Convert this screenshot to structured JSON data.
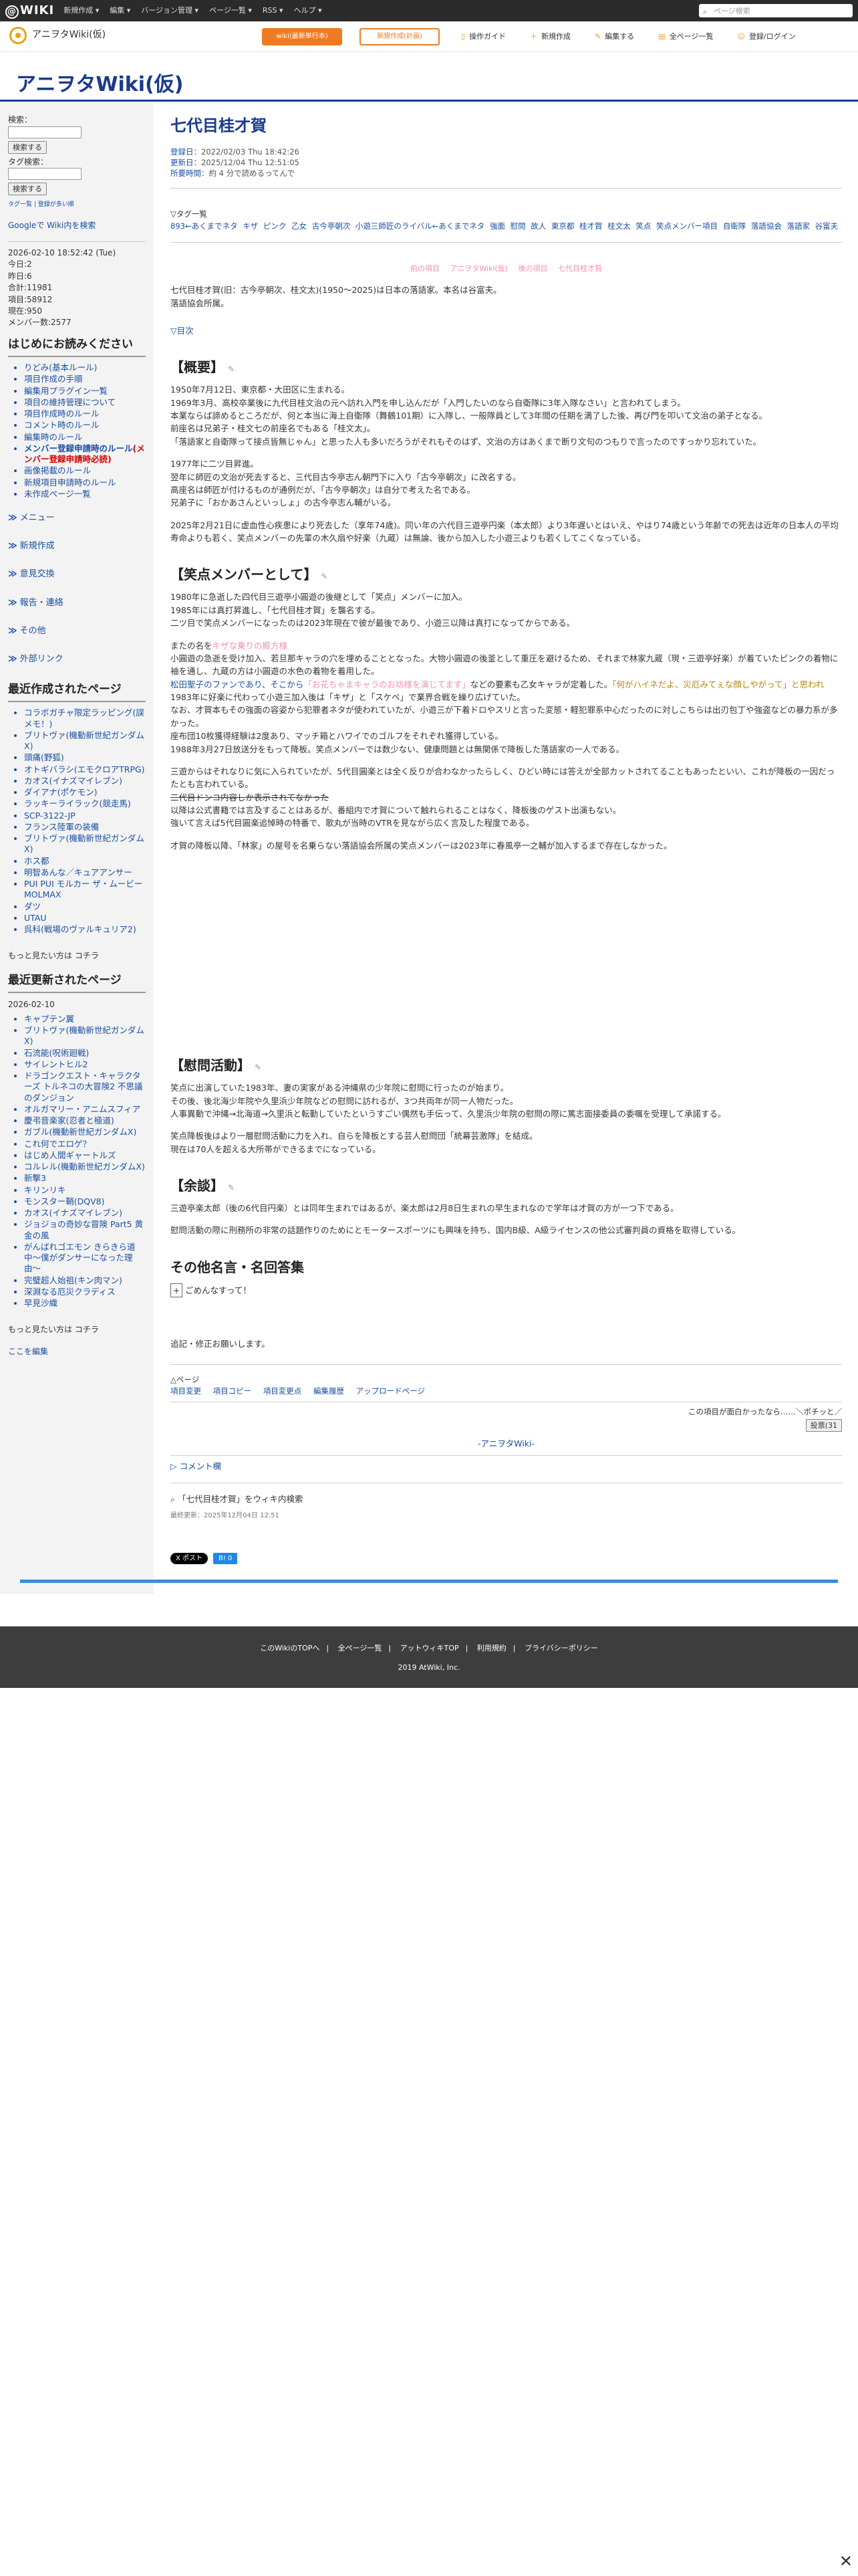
{
  "topbar": {
    "logo": "WIKI",
    "menu": [
      "新規作成 ▾",
      "編集 ▾",
      "バージョン管理 ▾",
      "ページ一覧 ▾",
      "RSS ▾",
      "ヘルプ ▾"
    ],
    "search_placeholder": "ページ検索"
  },
  "header": {
    "sitename": "アニヲタWiki(仮)",
    "btn_rank": "wiki(最新単行本)",
    "btn_ad": "新規作成(計画)",
    "links": [
      "操作ガイド",
      "新規作成",
      "編集する",
      "全ページ一覧",
      "登録/ログイン"
    ]
  },
  "title": "アニヲタWiki(仮)",
  "sidebar": {
    "search_label": "検索：",
    "search_btn": "検索する",
    "tag_label": "タグ検索：",
    "tag_btn": "検索する",
    "tag_link": "タグ一覧 | 登録が多い順",
    "google": "Googleで Wiki内を検索",
    "stats": [
      "2026-02-10 18:52:42 (Tue)",
      "今日:2",
      "昨日:6",
      "合計:11981",
      "項目:58912",
      "現在:950",
      "メンバー数:2577"
    ],
    "welcome_title": "はじめにお読みください",
    "welcome": [
      "りどみ(基本ルール)",
      "項目作成の手順",
      "編集用プラグイン一覧",
      "項目の維持管理について",
      "項目作成時のルール",
      "コメント時のルール",
      "編集時のルール"
    ],
    "member_rule": "メンバー登録申請時のルール",
    "member_rule_red": "(メンバー登録申請時必読)",
    "welcome2": [
      "画像掲載のルール",
      "新規項目申請時のルール",
      "未作成ページ一覧"
    ],
    "groups": [
      "メニュー",
      "新規作成",
      "意見交換",
      "報告・連絡",
      "その他",
      "外部リンク"
    ],
    "recent_title": "最近作成されたページ",
    "recent": [
      "コラボガチャ限定ラッピング(誤メモ！)",
      "ブリトヴァ(機動新世紀ガンダムX)",
      "頭痛(野狐)",
      "オトギバラシ(エモクロアTRPG)",
      "カオス(イナズマイレブン)",
      "ダイアナ(ポケモン)",
      "ラッキーライラック(競走馬)",
      "SCP-3122-JP",
      "フランス陸軍の装備",
      "ブリトヴァ(機動新世紀ガンダムX)",
      "ホス都",
      "明智あんな／キュアアンサー",
      "PUI PUI モルカー ザ・ムービー MOLMAX",
      "ダツ",
      "UTAU",
      "呉科(戦場のヴァルキュリア2)"
    ],
    "more1": "もっと見たい方は コチラ",
    "updated_title": "最近更新されたページ",
    "updated_date": "2026-02-10",
    "updated": [
      "キャプテン翼",
      "ブリトヴァ(機動新世紀ガンダムX)",
      "石流能(呪術廻戦)",
      "サイレントヒル2",
      "ドラゴンクエスト・キャラクターズ トルネコの大冒険2 不思議のダンジョン",
      "オルガマリー・アニムスフィア",
      "慶弔音楽家(忍者と極道)",
      "ガブル(機動新世紀ガンダムX)",
      "これ何でエロゲ？",
      "はじめ人間ギャートルズ",
      "コルレル(機動新世紀ガンダムX)",
      "新撃3",
      "キリンリキ",
      "モンスター鞘(DQV8)",
      "カオス(イナズマイレブン)",
      "ジョジョの奇妙な冒険 Part5 黄金の風",
      "がんばれゴエモン きらきら道中〜僕がダンサーになった理由〜",
      "完璧超人始祖(キン肉マン)",
      "深淵なる厄災クラディス",
      "早見沙織"
    ],
    "more2": "もっと見たい方は コチラ",
    "edit_here": "ここを編集"
  },
  "main": {
    "page_title": "七代目桂才賀",
    "meta": [
      {
        "k": "登録日",
        "v": "：2022/02/03 Thu 18:42:26"
      },
      {
        "k": "更新日",
        "v": "：2025/12/04 Thu 12:51:05"
      },
      {
        "k": "所要時間",
        "v": "：約 4 分で読めるってんで"
      }
    ],
    "tag_head": "▽タグ一覧",
    "tags": [
      "893←あくまでネタ",
      "キザ",
      "ピンク",
      "乙女",
      "古今亭朝次",
      "小遊三師匠のライバル←あくまでネタ",
      "強面",
      "慰問",
      "故人",
      "東京都",
      "桂才賀",
      "桂文太",
      "笑点",
      "笑点メンバー項目",
      "自衛隊",
      "落語協会",
      "落語家",
      "谷富夫"
    ],
    "nav": [
      "前の項目",
      "アニヲタWiki(仮)",
      "後の項目",
      "七代目桂才賀"
    ],
    "lead1": "七代目桂才賀(旧：古今亭朝次、桂文太)(1950〜2025)は日本の落語家。本名は谷富夫。",
    "lead2": "落語協会所属。",
    "toc": "▽目次",
    "sec1": "【概要】",
    "p1": [
      "1950年7月12日、東京都・大田区に生まれる。",
      "1969年3月、高校卒業後に九代目桂文治の元へ訪れ入門を申し込んだが「入門したいのなら自衛隊に3年入隊なさい」と言われてしまう。",
      "本業ならば諦めるところだが、何と本当に海上自衛隊（舞鶴101期）に入隊し、一般隊員として3年間の任期を満了した後、再び門を叩いて文治の弟子となる。",
      "前座名は兄弟子・桂文七の前座名でもある「桂文太」。",
      "「落語家と自衛隊って接点皆無じゃん」と思った人も多いだろうがそれもそのはず、文治の方はあくまで断り文句のつもりで言ったのですっかり忘れていた。"
    ],
    "p2": [
      "1977年に二ツ目昇進。",
      "翌年に師匠の文治が死去すると、三代目古今亭志ん朝門下に入り「古今亭朝次」に改名する。",
      "高座名は師匠が付けるものが通例だが、「古今亭朝次」は自分で考えた名である。",
      "兄弟子に「おかあさんといっしょ」の古今亭志ん輔がいる。"
    ],
    "p3": [
      "2025年2月21日に虚血性心疾患により死去した（享年74歳)。同い年の六代目三遊亭円楽（本太郎）より3年遅いとはいえ、やはり74歳という年齢での死去は近年の日本人の平均寿命よりも若く、笑点メンバーの先輩の木久扇や好楽（九蔵）は無論、後から加入した小遊三よりも若くしてこくなっている。"
    ],
    "sec2": "【笑点メンバーとして】",
    "p4": [
      "1980年に急逝した四代目三遊亭小圓遊の後継として「笑点」メンバーに加入。",
      "1985年には真打昇進し、「七代目桂才賀」を襲名する。",
      "二ツ目で笑点メンバーになったのは2023年現在で彼が最後であり、小遊三以降は真打になってからである。"
    ],
    "p5a": "またの名を",
    "p5a_pink": "キザな乗りの殿方様",
    "p5": [
      "小圓遊の急逝を受け加入、若旦那キャラの穴を埋めることとなった。大物小圓遊の後釜として重圧を避けるため、それまで林家九蔵（現・三遊亭好楽）が着ていたピンクの着物に袖を通し、九蔵の方は小圓遊の水色の着物を着用した。"
    ],
    "p5b": "松田聖子のファンであり、そこから",
    "p5b_pink": "「お花ちゃまキャラのお坊様を演じてます」",
    "p5c": "などの要素も乙女キャラが定着した。",
    "p5c_gold": "「何がハイネだよ、災厄みてぇな顔しやがって」と思われ",
    "p6": [
      "1983年に好楽に代わって小遊三加入後は「キザ」と「スケベ」で業界合戦を繰り広げていた。",
      "なお、才賀本もその強面の容姿から犯罪者ネタが使われていたが、小遊三が下着ドロやスリと言った変態・軽犯罪系中心だったのに対しこちらは出刃包丁や強盗などの暴力系が多かった。",
      "座布団10枚獲得経験は2度あり、マッチ箱とハワイでのゴルフをそれぞれ獲得している。",
      "1988年3月27日放送分をもって降板。笑点メンバーでは数少ない、健康問題とは無関係で降板した落語家の一人である。"
    ],
    "p7": [
      "三遊からはそれなりに気に入られていたが、5代目圓楽とは全く反りが合わなかったらしく、ひどい時には答えが全部カットされてることもあったといい、これが降板の一因だったとも言われている。"
    ],
    "p7_strike": "二代目ドンコ内容しか表示されてなかった",
    "p8": [
      "以降は公式書籍では言及することはあるが、番組内で才賀について触れられることはなく、降板後のゲスト出演もない。",
      "強いて言えば5代目圓楽追悼時の特番で、歌丸が当時のVTRを見ながら広く言及した程度である。"
    ],
    "p9": [
      "才賀の降板以降、「林家」の屋号を名乗らない落語協会所属の笑点メンバーは2023年に春風亭一之輔が加入するまで存在しなかった。"
    ],
    "sec3": "【慰問活動】",
    "p10": [
      "笑点に出演していた1983年、妻の実家がある沖縄県の少年院に慰問に行ったのが始まり。",
      "その後、後北海少年院や久里浜少年院などの慰問に訪れるが、3つ共両年が同一人物だった。",
      "人事異動で沖縄→北海道→久里浜と転勤していたというすごい偶然も手伝って、久里浜少年院の慰問の際に篤志面接委員の委嘱を受理して承諾する。"
    ],
    "p11": [
      "笑点降板後はより一層慰問活動に力を入れ、自らを降板とする芸人慰問団「統幕芸激隊」を結成。",
      "現在は70人を超える大所帯ができるまでになっている。"
    ],
    "sec4": "【余談】",
    "p12": [
      "三遊亭楽太郎（後の6代目円楽）とは同年生まれではあるが、楽太郎は2月8日生まれの早生まれなので学年は才賀の方が一つ下である。"
    ],
    "p13": [
      "慰問活動の際に刑務所の非常の話題作りのためにとモータースポーツにも興味を持ち、国内B級、A級ライセンスの他公式審判員の資格を取得している。"
    ],
    "sec5": "その他名言・名回答集",
    "plus": "+",
    "plus_text": "ごめんなすって！",
    "append": "追記・修正お願いします。",
    "bottom_tri": "△ページ",
    "bottom_links": [
      "項目変更",
      "項目コピー",
      "項目変更点",
      "編集履歴",
      "アップロードページ"
    ],
    "funny": "この項目が面白かったなら……＼ポチッと／",
    "vote_btn": "投票(31",
    "center_link": "-アニヲタWiki-",
    "comment": "▷ コメント欄",
    "search_wiki": "「七代目桂才賀」をウィキ内検索",
    "lastmod": "最終更新：2025年12月04日 12:51",
    "share1": "X ポスト",
    "share2": "B! 0"
  },
  "footer": {
    "links": [
      "このWikiのTOPへ",
      "全ページ一覧",
      "アットウィキTOP",
      "利用規約",
      "プライバシーポリシー"
    ],
    "copy": "2019 AtWiki, Inc."
  },
  "close": "✕"
}
